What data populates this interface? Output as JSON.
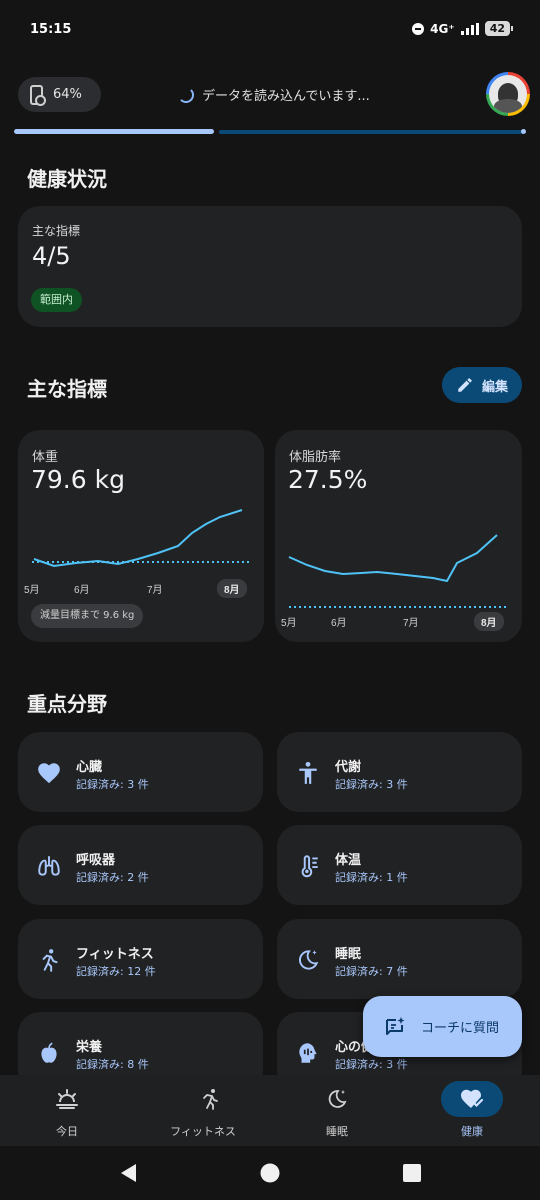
{
  "status_bar": {
    "time": "15:15",
    "network": "4G⁺",
    "battery": "42"
  },
  "header": {
    "device_battery": "64%",
    "loading_text": "データを読み込んでいます..."
  },
  "health_status": {
    "section_title": "健康状況",
    "label": "主な指標",
    "value": "4/5",
    "badge": "範囲内"
  },
  "key_metrics": {
    "section_title": "主な指標",
    "edit_label": "編集",
    "cards": [
      {
        "label": "体重",
        "value": "79.6 kg",
        "months": [
          "5月",
          "6月",
          "7月",
          "8月"
        ],
        "goal_chip": "減量目標まで 9.6 kg"
      },
      {
        "label": "体脂肪率",
        "value": "27.5%",
        "months": [
          "5月",
          "6月",
          "7月",
          "8月"
        ]
      }
    ]
  },
  "focus_areas": {
    "section_title": "重点分野",
    "items": [
      {
        "name": "心臓",
        "count": "記録済み: 3 件",
        "icon": "heart-icon"
      },
      {
        "name": "代謝",
        "count": "記録済み: 3 件",
        "icon": "person-icon"
      },
      {
        "name": "呼吸器",
        "count": "記録済み: 2 件",
        "icon": "lungs-icon"
      },
      {
        "name": "体温",
        "count": "記録済み: 1 件",
        "icon": "thermometer-icon"
      },
      {
        "name": "フィットネス",
        "count": "記録済み: 12 件",
        "icon": "running-icon"
      },
      {
        "name": "睡眠",
        "count": "記録済み: 7 件",
        "icon": "moon-icon"
      },
      {
        "name": "栄養",
        "count": "記録済み: 8 件",
        "icon": "apple-icon"
      },
      {
        "name": "心の健",
        "count": "記録済み: 3 件",
        "icon": "mind-icon"
      }
    ]
  },
  "coach_fab": {
    "label": "コーチに質問"
  },
  "bottom_nav": [
    {
      "label": "今日",
      "icon": "sunrise-icon"
    },
    {
      "label": "フィットネス",
      "icon": "running-icon"
    },
    {
      "label": "睡眠",
      "icon": "moon-icon"
    },
    {
      "label": "健康",
      "icon": "heart-check-icon",
      "active": true
    }
  ],
  "colors": {
    "accent": "#a8c7fa",
    "chart_line": "#4fc3f7",
    "card": "#212224",
    "background": "#141414"
  }
}
